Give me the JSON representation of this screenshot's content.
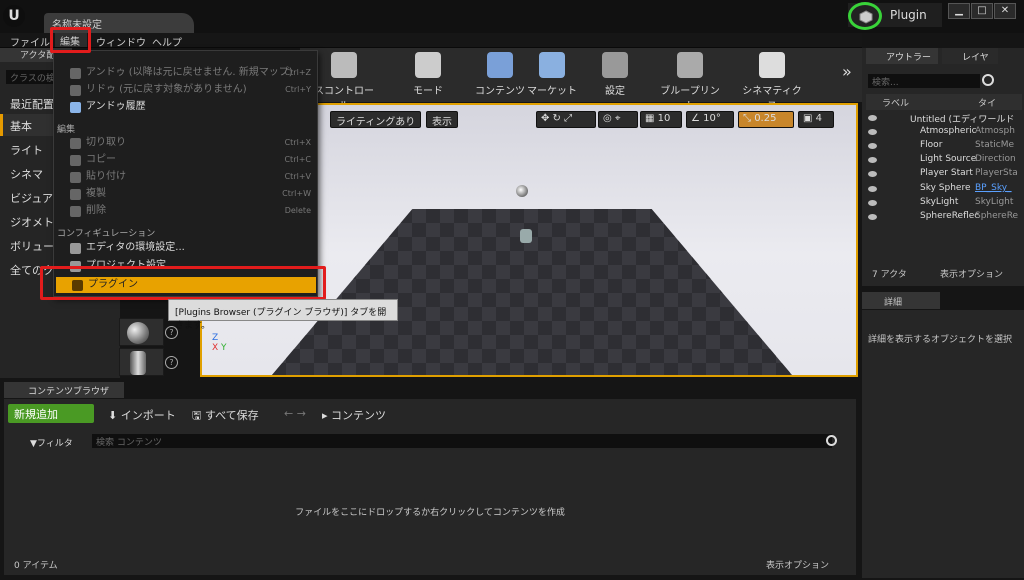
{
  "window": {
    "doc_tab": "名称未設定",
    "plugin_badge": "Plugin",
    "btn_min": "▁",
    "btn_max": "□",
    "btn_close": "✕"
  },
  "menubar": [
    "ファイル",
    "編集",
    "ウィンドウ",
    "ヘルプ"
  ],
  "left_panel": {
    "tab": "アクタ配置",
    "search_placeholder": "クラスの検",
    "categories": [
      "最近配置",
      "基本",
      "ライト",
      "シネマ",
      "ビジュア",
      "ジオメト",
      "ボリューム",
      "全てのク"
    ]
  },
  "toolbar": {
    "buttons": [
      "スコントロール",
      "モード",
      "コンテンツ",
      "マーケット",
      "設定",
      "ブループリント",
      "シネマティクス"
    ],
    "more": "»"
  },
  "viewport": {
    "lighting_label": "ライティングあり",
    "show_label": "表示",
    "grid_value": "10",
    "rotation_value": "10°",
    "scale_value": "0.25",
    "camera_speed": "4",
    "axis_z": "Z",
    "axis_x": "X",
    "axis_y": "Y"
  },
  "edit_menu": {
    "undo": "アンドゥ (以降は元に戻せません. 新規マップ)",
    "undo_sc": "Ctrl+Z",
    "redo": "リドゥ (元に戻す対象がありません)",
    "redo_sc": "Ctrl+Y",
    "history": "アンドゥ履歴",
    "section_edit": "編集",
    "cut": "切り取り",
    "cut_sc": "Ctrl+X",
    "copy": "コピー",
    "copy_sc": "Ctrl+C",
    "paste": "貼り付け",
    "paste_sc": "Ctrl+V",
    "duplicate": "複製",
    "duplicate_sc": "Ctrl+W",
    "delete": "削除",
    "delete_sc": "Delete",
    "section_config": "コンフィギュレーション",
    "editor_prefs": "エディタの環境設定...",
    "project_settings": "プロジェクト設定...",
    "plugins": "プラグイン"
  },
  "tooltip": "[Plugins Browser (プラグイン ブラウザ)] タブを開きます。",
  "outliner": {
    "tab": "アウトラー",
    "layers_tab": "レイヤ",
    "search_placeholder": "検索...",
    "col_label": "ラベル",
    "col_type": "タイ",
    "root": "Untitled (エディワールド",
    "rows": [
      {
        "name": "Atmospheric",
        "type": "Atmosph"
      },
      {
        "name": "Floor",
        "type": "StaticMe"
      },
      {
        "name": "Light Source",
        "type": "Direction"
      },
      {
        "name": "Player Start",
        "type": "PlayerSta"
      },
      {
        "name": "Sky Sphere",
        "type": "BP_Sky_"
      },
      {
        "name": "SkyLight",
        "type": "SkyLight"
      },
      {
        "name": "SphereReflec",
        "type": "SphereRe"
      }
    ],
    "count": "7 アクタ",
    "view_options": "表示オプション"
  },
  "details": {
    "tab": "詳細",
    "hint": "詳細を表示するオブジェクトを選択"
  },
  "content_browser": {
    "tab": "コンテンツブラウザ",
    "add_new": "新規追加",
    "import": "インポート",
    "save_all": "すべて保存",
    "path": "コンテンツ",
    "filters": "フィルタ",
    "search_placeholder": "検索 コンテンツ",
    "empty_hint": "ファイルをここにドロップするか右クリックしてコンテンツを作成",
    "item_count": "0 アイテム",
    "view_options": "表示オプション"
  },
  "colors": {
    "accent": "#e8a200",
    "highlight": "#e21c1c",
    "add_button": "#4a9a24"
  }
}
